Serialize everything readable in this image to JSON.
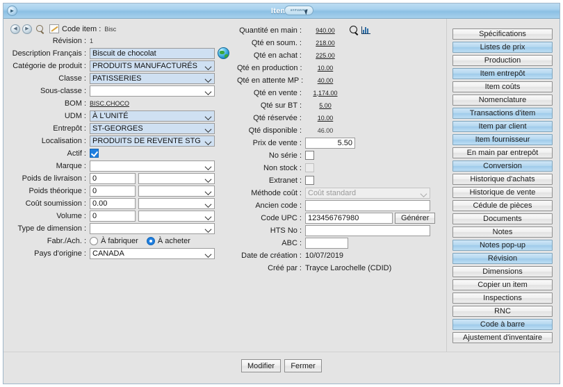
{
  "window": {
    "title": "Items",
    "logo_text": "anmawww",
    "menu_icon": "play-circle-icon"
  },
  "toolbar": {
    "back_icon": "back-arrow-icon",
    "forward_icon": "forward-arrow-icon",
    "search_icon": "magnifier-icon",
    "edit_icon": "pencil-icon"
  },
  "left": {
    "code_item": {
      "label": "Code item :",
      "value": "Bisc"
    },
    "revision": {
      "label": "Révision :",
      "value": "1"
    },
    "description_fr": {
      "label": "Description Français :",
      "value": "Biscuit de chocolat"
    },
    "categorie_produit": {
      "label": "Catégorie de produit :",
      "value": "PRODUITS MANUFACTURÉS"
    },
    "classe": {
      "label": "Classe :",
      "value": "PATISSERIES"
    },
    "sous_classe": {
      "label": "Sous-classe :",
      "value": ""
    },
    "bom": {
      "label": "BOM :",
      "value": "BISC.CHOCO"
    },
    "udm": {
      "label": "UDM :",
      "value": "À L'UNITÉ"
    },
    "entrepot": {
      "label": "Entrepôt :",
      "value": "ST-GEORGES"
    },
    "localisation": {
      "label": "Localisation  :",
      "value": "PRODUITS DE REVENTE STG"
    },
    "actif": {
      "label": "Actif :",
      "checked": true
    },
    "marque": {
      "label": "Marque :",
      "value": ""
    },
    "poids_livraison": {
      "label": "Poids de livraison :",
      "value": "0",
      "unit": ""
    },
    "poids_theorique": {
      "label": "Poids théorique :",
      "value": "0",
      "unit": ""
    },
    "cout_soumission": {
      "label": "Coût soumission :",
      "value": "0.00",
      "unit": ""
    },
    "volume": {
      "label": "Volume :",
      "value": "0",
      "unit": ""
    },
    "type_dimension": {
      "label": "Type de dimension :",
      "value": ""
    },
    "fabr_ach": {
      "label": "Fabr./Ach. :",
      "option_fabriquer": "À fabriquer",
      "option_acheter": "À acheter",
      "selected": "acheter"
    },
    "pays_origine": {
      "label": "Pays d'origine :",
      "value": "CANADA"
    }
  },
  "mid": {
    "quantite_en_main": {
      "label": "Quantité en main :",
      "value": "940.00",
      "has_search": true,
      "has_chart": true
    },
    "qte_en_soum": {
      "label": "Qté en soum. :",
      "value": "218.00"
    },
    "qte_en_achat": {
      "label": "Qté en achat :",
      "value": "225.00"
    },
    "qte_en_production": {
      "label": "Qté en production :",
      "value": "10.00"
    },
    "qte_en_attente_mp": {
      "label": "Qté en attente MP :",
      "value": "40.00"
    },
    "qte_en_vente": {
      "label": "Qté en vente :",
      "value": "1,174.00"
    },
    "qte_sur_bt": {
      "label": "Qté sur BT :",
      "value": "5.00"
    },
    "qte_reservee": {
      "label": "Qté réservée :",
      "value": "10.00"
    },
    "qte_disponible": {
      "label": "Qté disponible :",
      "value": "46.00"
    },
    "prix_de_vente": {
      "label": "Prix de vente :",
      "value": "5.50"
    },
    "no_serie": {
      "label": "No série :",
      "checked": false
    },
    "non_stock": {
      "label": "Non stock :",
      "checked": false,
      "disabled": true
    },
    "extranet": {
      "label": "Extranet :",
      "checked": false
    },
    "methode_cout": {
      "label": "Méthode coût :",
      "value": "Coût standard",
      "disabled": true
    },
    "ancien_code": {
      "label": "Ancien code :",
      "value": ""
    },
    "code_upc": {
      "label": "Code UPC :",
      "value": "123456767980",
      "button": "Générer"
    },
    "hts_no": {
      "label": "HTS No :",
      "value": ""
    },
    "abc": {
      "label": "ABC :",
      "value": ""
    },
    "date_creation": {
      "label": "Date de création :",
      "value": "10/07/2019"
    },
    "cree_par": {
      "label": "Créé par :",
      "value": "Trayce Larochelle (CDID)"
    }
  },
  "side_buttons": [
    {
      "label": "Spécifications",
      "highlighted": false
    },
    {
      "label": "Listes de prix",
      "highlighted": true
    },
    {
      "label": "Production",
      "highlighted": false
    },
    {
      "label": "Item entrepôt",
      "highlighted": true
    },
    {
      "label": "Item coûts",
      "highlighted": false
    },
    {
      "label": "Nomenclature",
      "highlighted": false
    },
    {
      "label": "Transactions d'item",
      "highlighted": true
    },
    {
      "label": "Item par client",
      "highlighted": true
    },
    {
      "label": "Item fournisseur",
      "highlighted": true
    },
    {
      "label": "En main par entrepôt",
      "highlighted": false
    },
    {
      "label": "Conversion",
      "highlighted": true
    },
    {
      "label": "Historique d'achats",
      "highlighted": false
    },
    {
      "label": "Historique de vente",
      "highlighted": false
    },
    {
      "label": "Cédule de pièces",
      "highlighted": false
    },
    {
      "label": "Documents",
      "highlighted": false
    },
    {
      "label": "Notes",
      "highlighted": false
    },
    {
      "label": "Notes pop-up",
      "highlighted": true
    },
    {
      "label": "Révision",
      "highlighted": true
    },
    {
      "label": "Dimensions",
      "highlighted": false
    },
    {
      "label": "Copier un item",
      "highlighted": false
    },
    {
      "label": "Inspections",
      "highlighted": false
    },
    {
      "label": "RNC",
      "highlighted": false
    },
    {
      "label": "Code à barre",
      "highlighted": true
    },
    {
      "label": "Ajustement d'inventaire",
      "highlighted": false
    }
  ],
  "footer": {
    "modifier": "Modifier",
    "fermer": "Fermer"
  },
  "annotation": {
    "arrow": "black-arrow-pointing-left"
  },
  "colors": {
    "title_bar": "#8cc0e4",
    "field_blue": "#cfe0f2",
    "button_highlight": "#b4d7ef",
    "window_bg": "#e4e4e4"
  }
}
